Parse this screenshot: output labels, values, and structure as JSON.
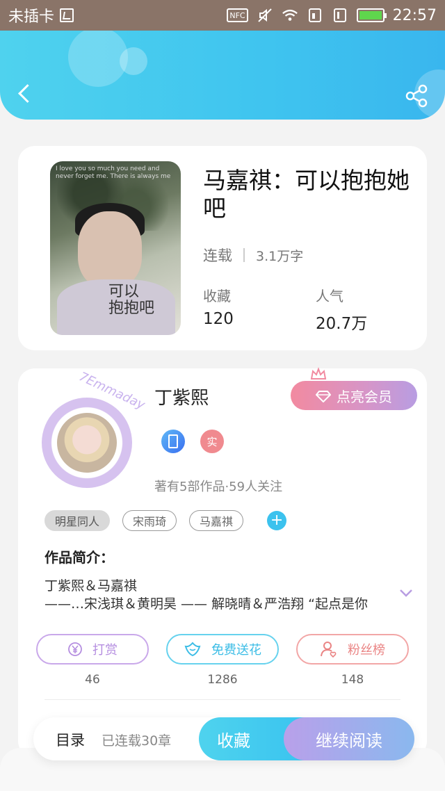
{
  "status_bar": {
    "carrier": "未插卡",
    "nfc": "NFC",
    "time": "22:57"
  },
  "book": {
    "title": "马嘉祺：可以抱抱她吧",
    "status": "连载",
    "word_count": "3.1万字",
    "favorites_label": "收藏",
    "favorites_value": "120",
    "popularity_label": "人气",
    "popularity_value": "20.7万",
    "cover_text": "可以\n抱抱吧",
    "cover_top_text": "I love you so much you need and never forget me. There is always me"
  },
  "author": {
    "name": "丁紫熙",
    "vip_button": "点亮会员",
    "badge_real": "实",
    "stats": "著有5部作品·59人关注",
    "avatar_deco_text": "7Emmaday",
    "tags": [
      "明星同人",
      "宋雨琦",
      "马嘉祺"
    ],
    "tag_add": "+",
    "intro_label": "作品简介：",
    "intro_lines": [
      "丁紫熙＆马嘉祺",
      "——…宋浅琪＆黄明昊 —— 解晓晴＆严浩翔 “起点是你"
    ]
  },
  "actions": {
    "tip": {
      "label": "打赏",
      "count": "46",
      "icon": "yen-icon"
    },
    "flower": {
      "label": "免费送花",
      "count": "1286",
      "icon": "flower-icon"
    },
    "fans": {
      "label": "粉丝榜",
      "count": "148",
      "icon": "person-icon"
    }
  },
  "bottom_bar": {
    "toc_label": "目录",
    "toc_status": "已连载30章",
    "favorite_button": "收藏",
    "read_button": "继续阅读"
  },
  "colors": {
    "header": "#3fc4ef",
    "accent_purple": "#b89de2",
    "accent_pink": "#f28aa0"
  }
}
